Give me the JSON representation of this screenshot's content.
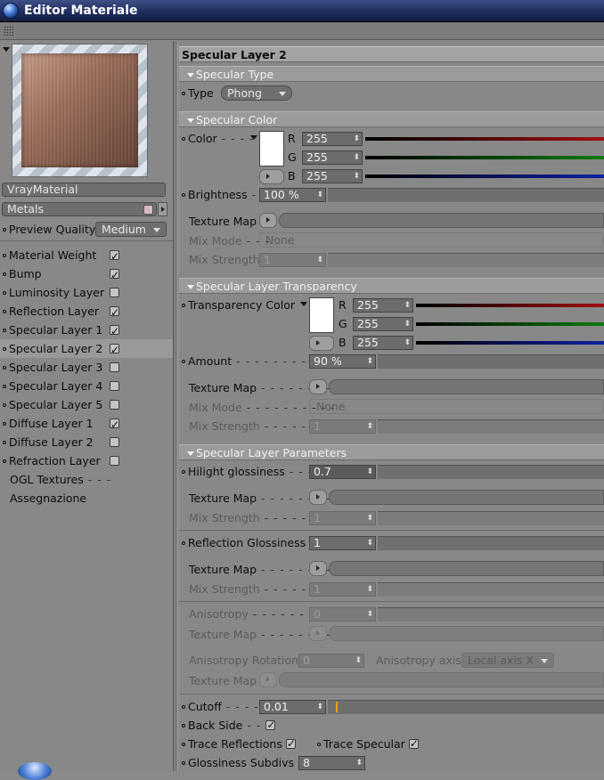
{
  "window": {
    "title": "Editor Materiale"
  },
  "left": {
    "material_name": "VrayMaterial",
    "material_type": "Metals",
    "preview_quality_label": "Preview Quality",
    "preview_quality_value": "Medium",
    "channels": [
      {
        "label": "Material Weight",
        "checked": true
      },
      {
        "label": "Bump",
        "checked": true
      },
      {
        "label": "Luminosity Layer",
        "checked": false
      },
      {
        "label": "Reflection Layer",
        "checked": true
      },
      {
        "label": "Specular Layer 1",
        "checked": true
      },
      {
        "label": "Specular Layer 2",
        "checked": true,
        "selected": true
      },
      {
        "label": "Specular Layer 3",
        "checked": false
      },
      {
        "label": "Specular Layer 4",
        "checked": false
      },
      {
        "label": "Specular Layer 5",
        "checked": false
      },
      {
        "label": "Diffuse Layer 1",
        "checked": true
      },
      {
        "label": "Diffuse Layer 2",
        "checked": false
      },
      {
        "label": "Refraction Layer",
        "checked": false
      }
    ],
    "extra_items": [
      "OGL Textures",
      "Assegnazione"
    ]
  },
  "right": {
    "heading": "Specular Layer 2",
    "spec_type": {
      "section": "Specular Type",
      "type_label": "Type",
      "type_value": "Phong"
    },
    "spec_color": {
      "section": "Specular Color",
      "color_label": "Color",
      "r_label": "R",
      "g_label": "G",
      "b_label": "B",
      "r": "255",
      "g": "255",
      "b": "255",
      "brightness_label": "Brightness",
      "brightness_value": "100 %",
      "texture_label": "Texture Map",
      "mix_mode_label": "Mix Mode",
      "mix_mode_value": "None",
      "mix_strength_label": "Mix Strength",
      "mix_strength_value": "1"
    },
    "transparency": {
      "section": "Specular Layer Transparency",
      "color_label": "Transparency Color",
      "r_label": "R",
      "g_label": "G",
      "b_label": "B",
      "r": "255",
      "g": "255",
      "b": "255",
      "amount_label": "Amount",
      "amount_value": "90 %",
      "texture_label": "Texture Map",
      "mix_mode_label": "Mix Mode",
      "mix_mode_value": "None",
      "mix_strength_label": "Mix Strength",
      "mix_strength_value": "1"
    },
    "params": {
      "section": "Specular Layer Parameters",
      "hilight_label": "Hilight glossiness",
      "hilight_value": "0.7",
      "texture_label": "Texture Map",
      "mix_strength_label": "Mix Strength",
      "mix_strength_value": "1",
      "refl_gloss_label": "Reflection Glossiness",
      "refl_gloss_value": "1",
      "texture2_label": "Texture Map",
      "mix_strength2_label": "Mix Strength",
      "mix_strength2_value": "1",
      "aniso_label": "Anisotropy",
      "aniso_value": "0",
      "texture3_label": "Texture Map",
      "aniso_rot_label": "Anisotropy Rotation",
      "aniso_rot_value": "0",
      "aniso_axis_label": "Anisotropy axis",
      "aniso_axis_value": "Local axis X",
      "texture4_label": "Texture Map",
      "cutoff_label": "Cutoff",
      "cutoff_value": "0.01",
      "backside_label": "Back Side",
      "trace_refl_label": "Trace Reflections",
      "trace_spec_label": "Trace Specular",
      "gloss_subdivs_label": "Glossiness Subdivs",
      "gloss_subdivs_value": "8"
    }
  },
  "colors": {
    "red_bar": "#a01010",
    "green_bar": "#0f7a0f",
    "blue_bar": "#1020a0"
  }
}
